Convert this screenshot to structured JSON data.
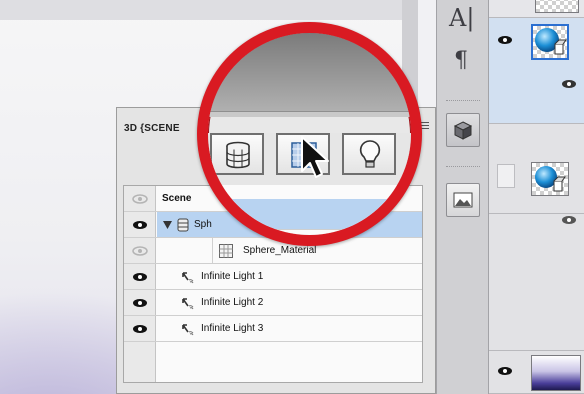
{
  "panel": {
    "title": "3D {SCENE",
    "rows": [
      {
        "label": "Scene",
        "type": "scene"
      },
      {
        "label": "Sph",
        "type": "mesh"
      },
      {
        "label": "Sphere_Material",
        "type": "material"
      },
      {
        "label": "Infinite Light 1",
        "type": "light"
      },
      {
        "label": "Infinite Light 2",
        "type": "light"
      },
      {
        "label": "Infinite Light 3",
        "type": "light"
      }
    ]
  },
  "toolbar": {
    "buttons": [
      {
        "icon": "scene-filter-icon"
      },
      {
        "icon": "material-filter-icon"
      },
      {
        "icon": "light-filter-icon"
      }
    ]
  },
  "side_strip": {
    "glyphs": [
      "A|",
      "¶"
    ]
  },
  "colors": {
    "accent_red": "#d91a22",
    "selection": "#b8d3f1",
    "panel_bg": "#e4e4e4"
  }
}
